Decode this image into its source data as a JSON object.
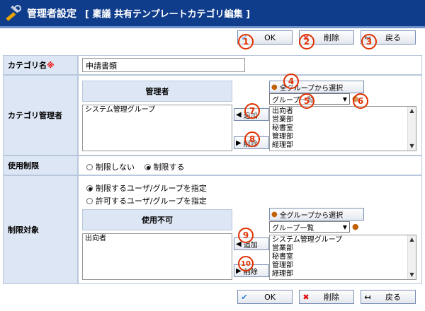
{
  "title": "管理者設定",
  "subtitle": "[ 稟議 共有テンプレートカテゴリ編集 ]",
  "toolbar": {
    "ok": "OK",
    "delete": "削除",
    "back": "戻る"
  },
  "markers": [
    "1",
    "2",
    "3",
    "4",
    "5",
    "6",
    "7",
    "8",
    "9",
    "10"
  ],
  "fields": {
    "category_name_label": "カテゴリ名",
    "required_mark": "※",
    "category_name_value": "申請書類",
    "manager_label": "カテゴリ管理者",
    "manager_header": "管理者",
    "manager_list": [
      "システム管理グループ"
    ],
    "select_all_groups": "全グループから選択",
    "group_select_value": "グループ一覧",
    "add_label": "追加",
    "remove_label": "削除",
    "group_options": [
      "出向者",
      "営業部",
      "秘書室",
      "管理部",
      "経理部"
    ],
    "usage_label": "使用制限",
    "usage_options": [
      {
        "label": "制限しない",
        "checked": false
      },
      {
        "label": "制限する",
        "checked": true
      }
    ],
    "target_label": "制限対象",
    "target_options": [
      {
        "label": "制限するユーザ/グループを指定",
        "checked": true
      },
      {
        "label": "許可するユーザ/グループを指定",
        "checked": false
      }
    ],
    "unusable_header": "使用不可",
    "unusable_list": [
      "出向者"
    ],
    "group_options2": [
      "システム管理グループ",
      "営業部",
      "秘書室",
      "管理部",
      "経理部"
    ]
  },
  "colors": {
    "header_bg": "#0f3d8c",
    "label_bg": "#dde6f4",
    "marker": "#e03000"
  }
}
